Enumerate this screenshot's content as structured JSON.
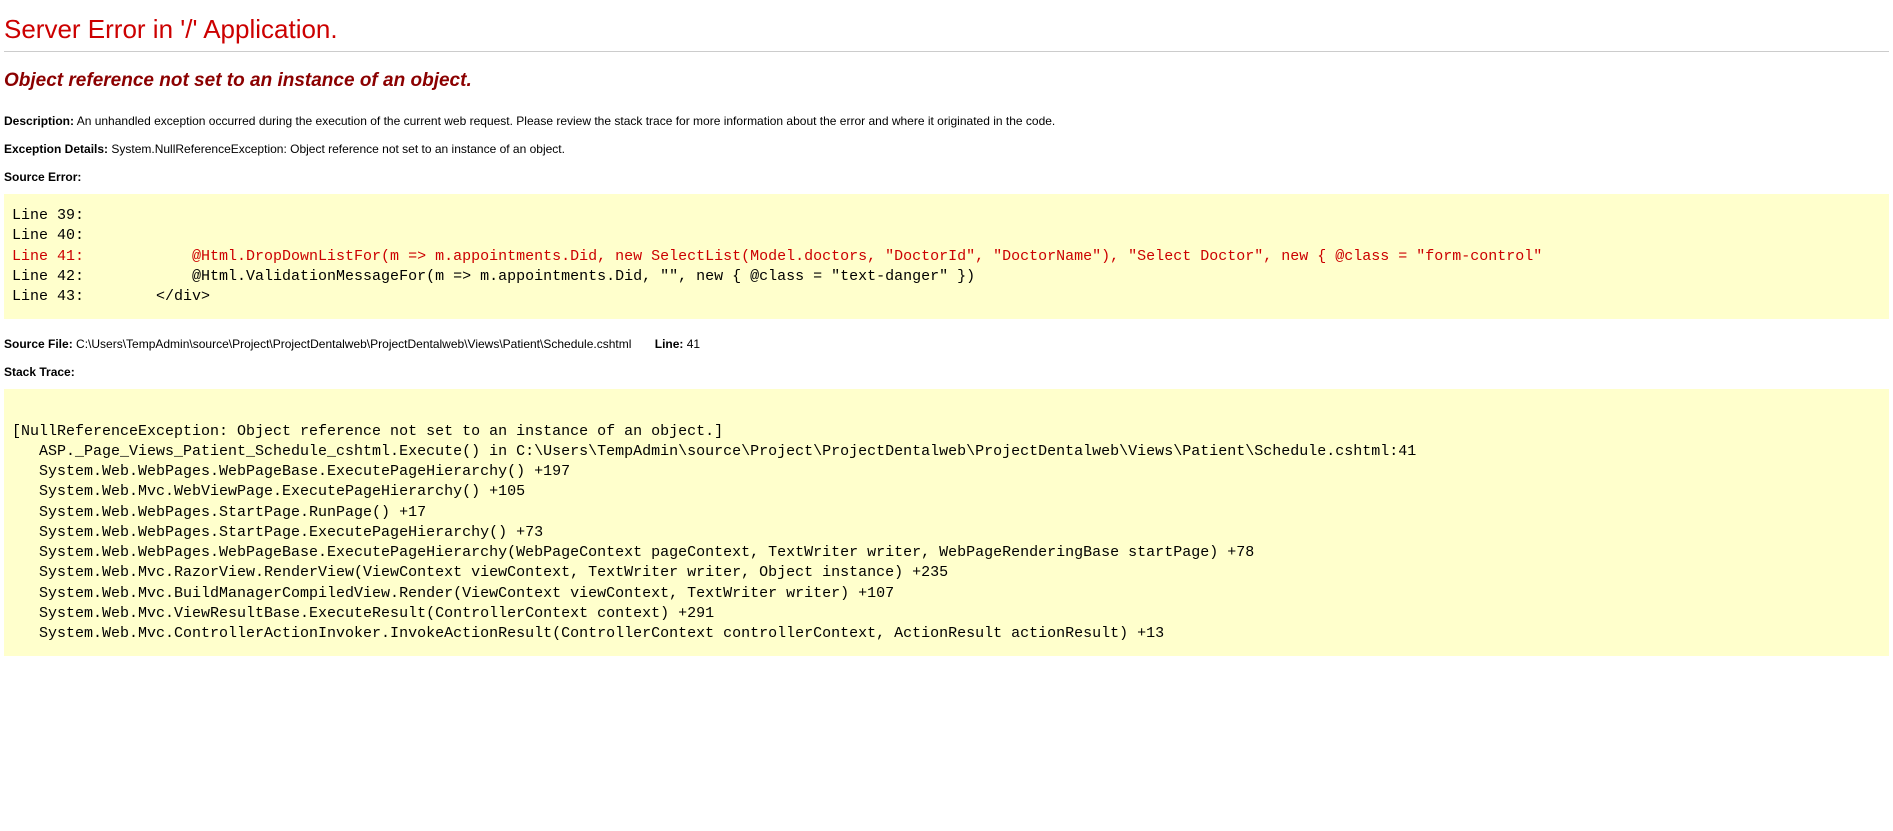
{
  "title": "Server Error in '/' Application.",
  "exception_message": "Object reference not set to an instance of an object.",
  "description_label": "Description:",
  "description_text": "An unhandled exception occurred during the execution of the current web request. Please review the stack trace for more information about the error and where it originated in the code.",
  "exception_details_label": "Exception Details:",
  "exception_details_text": "System.NullReferenceException: Object reference not set to an instance of an object.",
  "source_error_label": "Source Error:",
  "source_lines": {
    "line39": "Line 39:",
    "line40": "Line 40:",
    "line41": "Line 41:            @Html.DropDownListFor(m => m.appointments.Did, new SelectList(Model.doctors, \"DoctorId\", \"DoctorName\"), \"Select Doctor\", new { @class = \"form-control\"",
    "line42": "Line 42:            @Html.ValidationMessageFor(m => m.appointments.Did, \"\", new { @class = \"text-danger\" })",
    "line43": "Line 43:        </div>"
  },
  "source_file_label": "Source File:",
  "source_file_text": "C:\\Users\\TempAdmin\\source\\Project\\ProjectDentalweb\\ProjectDentalweb\\Views\\Patient\\Schedule.cshtml",
  "line_label": "Line:",
  "line_number": "41",
  "stack_trace_label": "Stack Trace:",
  "stack_trace": "\n[NullReferenceException: Object reference not set to an instance of an object.]\n   ASP._Page_Views_Patient_Schedule_cshtml.Execute() in C:\\Users\\TempAdmin\\source\\Project\\ProjectDentalweb\\ProjectDentalweb\\Views\\Patient\\Schedule.cshtml:41\n   System.Web.WebPages.WebPageBase.ExecutePageHierarchy() +197\n   System.Web.Mvc.WebViewPage.ExecutePageHierarchy() +105\n   System.Web.WebPages.StartPage.RunPage() +17\n   System.Web.WebPages.StartPage.ExecutePageHierarchy() +73\n   System.Web.WebPages.WebPageBase.ExecutePageHierarchy(WebPageContext pageContext, TextWriter writer, WebPageRenderingBase startPage) +78\n   System.Web.Mvc.RazorView.RenderView(ViewContext viewContext, TextWriter writer, Object instance) +235\n   System.Web.Mvc.BuildManagerCompiledView.Render(ViewContext viewContext, TextWriter writer) +107\n   System.Web.Mvc.ViewResultBase.ExecuteResult(ControllerContext context) +291\n   System.Web.Mvc.ControllerActionInvoker.InvokeActionResult(ControllerContext controllerContext, ActionResult actionResult) +13"
}
